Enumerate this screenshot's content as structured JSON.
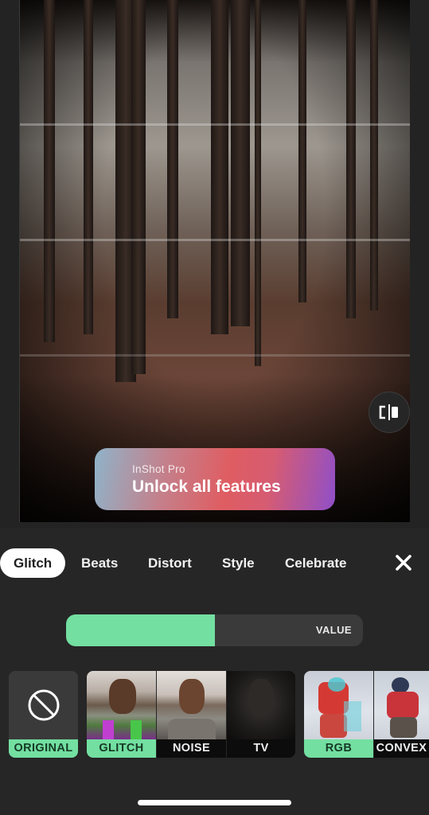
{
  "preview": {
    "description": "glitch-filtered forest photo",
    "compare_icon": "split-compare-icon"
  },
  "promo": {
    "subtitle": "InShot Pro",
    "title": "Unlock all features"
  },
  "tabs": [
    {
      "label": "Glitch",
      "active": true
    },
    {
      "label": "Beats",
      "active": false
    },
    {
      "label": "Distort",
      "active": false
    },
    {
      "label": "Style",
      "active": false
    },
    {
      "label": "Celebrate",
      "active": false
    }
  ],
  "close_icon": "close-icon",
  "slider": {
    "label": "VALUE",
    "value_percent": 50,
    "fill_color": "#73dfa1"
  },
  "effects": [
    {
      "label": "ORIGINAL",
      "icon": "no-effect-icon",
      "selected_style": "green"
    },
    {
      "label": "GLITCH",
      "selected_style": "green"
    },
    {
      "label": "NOISE",
      "selected_style": "black"
    },
    {
      "label": "TV",
      "selected_style": "black"
    },
    {
      "label": "RGB",
      "selected_style": "green"
    },
    {
      "label": "CONVEX",
      "selected_style": "black"
    }
  ],
  "colors": {
    "background": "#262626",
    "accent": "#73dfa1",
    "tab_active_bg": "#ffffff"
  }
}
